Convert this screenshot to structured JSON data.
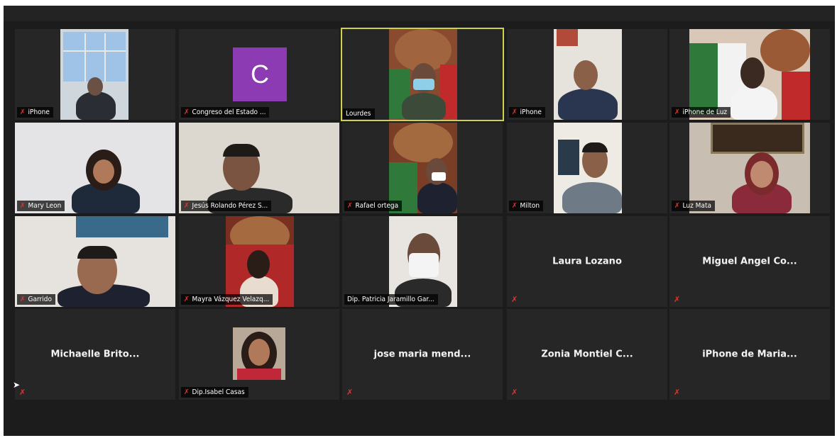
{
  "participants": [
    {
      "name": "iPhone",
      "muted": true
    },
    {
      "name": "Congreso del Estado ...",
      "muted": true,
      "avatar_letter": "C"
    },
    {
      "name": "Lourdes",
      "muted": false,
      "active": true
    },
    {
      "name": "iPhone",
      "muted": true
    },
    {
      "name": "iPhone de Luz",
      "muted": true
    },
    {
      "name": "Mary Leon",
      "muted": true
    },
    {
      "name": "Jesús Rolando Pérez S...",
      "muted": true
    },
    {
      "name": "Rafael ortega",
      "muted": true
    },
    {
      "name": "Milton",
      "muted": true
    },
    {
      "name": "Luz Mata",
      "muted": true
    },
    {
      "name": "Garrido",
      "muted": true
    },
    {
      "name": "Mayra Vázquez Velazq...",
      "muted": true
    },
    {
      "name": "Dip. Patricia Jaramillo Gar...",
      "muted": false
    },
    {
      "name": "Laura Lozano",
      "muted": true,
      "video_off": true
    },
    {
      "name": "Miguel Angel Co...",
      "muted": true,
      "video_off": true
    },
    {
      "name": "Michaelle Brito...",
      "muted": true,
      "video_off": true
    },
    {
      "name": "Dip.Isabel Casas",
      "muted": true
    },
    {
      "name": "jose maria mend...",
      "muted": true,
      "video_off": true
    },
    {
      "name": "Zonia Montiel C...",
      "muted": true,
      "video_off": true
    },
    {
      "name": "iPhone de Maria...",
      "muted": true,
      "video_off": true
    }
  ],
  "icons": {
    "muted_mic": "muted-mic-icon",
    "cursor": "mouse-pointer-icon"
  },
  "colors": {
    "background": "#1c1c1c",
    "tile": "#262626",
    "active_border": "#cfd24a",
    "muted": "#e0362c",
    "avatar": "#8c3bb3"
  }
}
